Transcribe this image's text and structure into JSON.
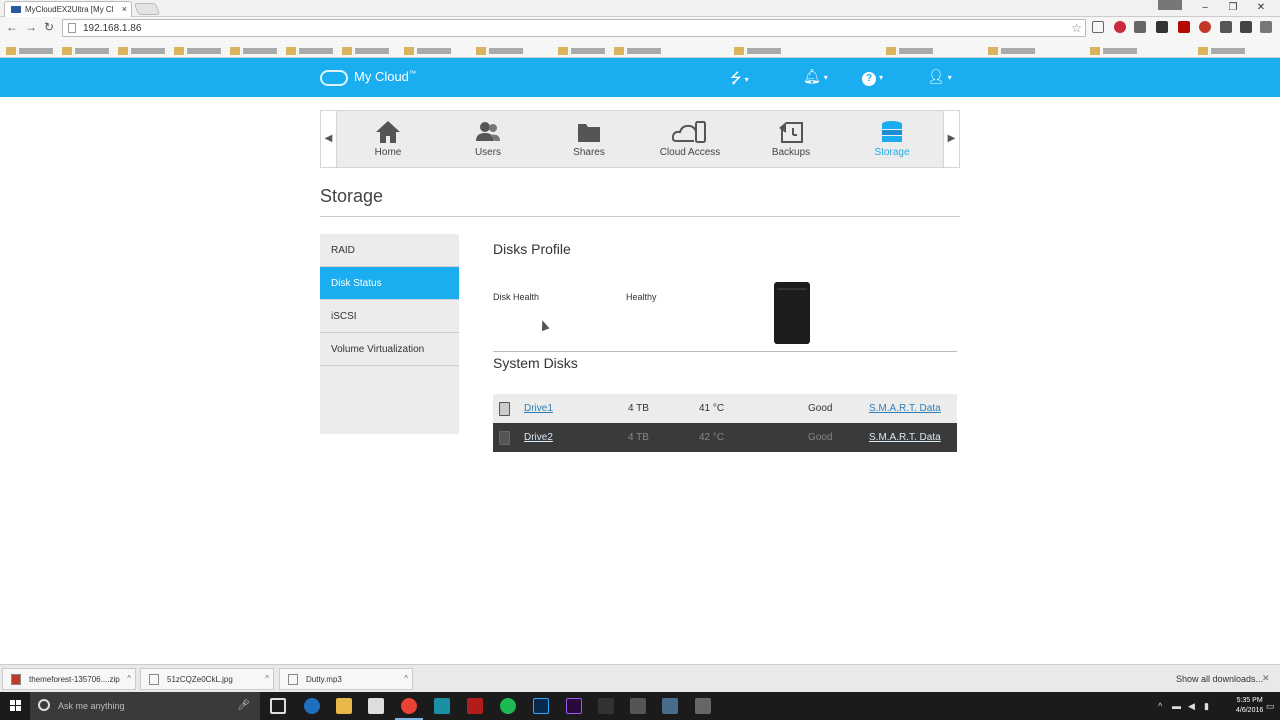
{
  "browser": {
    "tab_title": "MyCloudEX2Ultra [My Cl",
    "tab_close": "×",
    "url": "192.168.1.86",
    "window_controls": [
      "–",
      "❐",
      "✕"
    ]
  },
  "header": {
    "brand": "My Cloud",
    "brand_sup": "™"
  },
  "nav": {
    "items": [
      {
        "label": "Home"
      },
      {
        "label": "Users"
      },
      {
        "label": "Shares"
      },
      {
        "label": "Cloud Access"
      },
      {
        "label": "Backups"
      },
      {
        "label": "Storage"
      }
    ],
    "active": "Storage"
  },
  "page": {
    "title": "Storage"
  },
  "sidebar": {
    "items": [
      {
        "label": "RAID"
      },
      {
        "label": "Disk Status"
      },
      {
        "label": "iSCSI"
      },
      {
        "label": "Volume Virtualization"
      }
    ],
    "active": "Disk Status"
  },
  "disks_profile": {
    "heading": "Disks Profile",
    "health_label": "Disk Health",
    "health_value": "Healthy"
  },
  "system_disks": {
    "heading": "System Disks",
    "rows": [
      {
        "name": "Drive1",
        "size": "4 TB",
        "temp": "41 °C",
        "status": "Good",
        "link": "S.M.A.R.T. Data"
      },
      {
        "name": "Drive2",
        "size": "4 TB",
        "temp": "42 °C",
        "status": "Good",
        "link": "S.M.A.R.T. Data"
      }
    ]
  },
  "downloads": {
    "items": [
      {
        "name": "themeforest-135706....zip"
      },
      {
        "name": "51zCQZe0CkL.jpg"
      },
      {
        "name": "Dutty.mp3"
      }
    ],
    "show_all": "Show all downloads...",
    "close": "✕"
  },
  "taskbar": {
    "search_placeholder": "Ask me anything",
    "time": "5:35 PM",
    "date": "4/6/2016"
  },
  "colors": {
    "accent": "#1aaef0",
    "active_row_dark": "#3a3a3a",
    "sidebar_bg": "#ececec"
  }
}
